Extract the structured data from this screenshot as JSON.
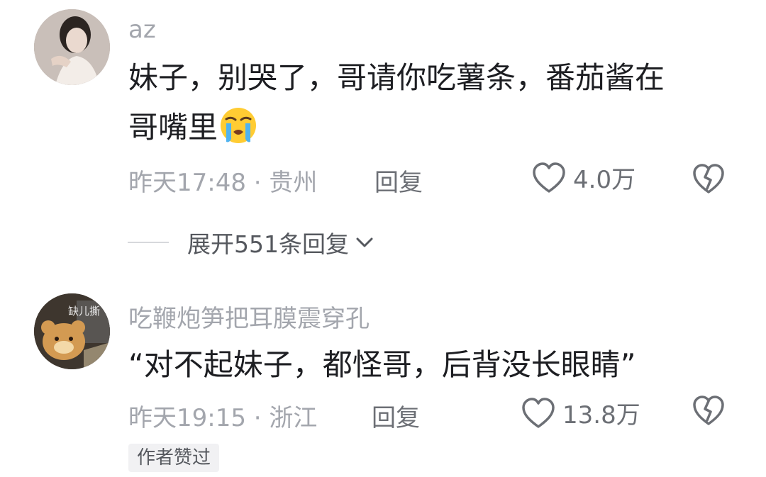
{
  "comments": [
    {
      "username": "az",
      "text_line1": "妹子，别哭了，哥请你吃薯条，番茄酱在",
      "text_line2": "哥嘴里",
      "emoji": "loudly-crying-face",
      "meta": "昨天17:48 · 贵州",
      "reply_label": "回复",
      "likes": "4.0万",
      "expand_label": "展开551条回复"
    },
    {
      "username": "吃鞭炮笋把耳膜震穿孔",
      "text": "“对不起妹子，都怪哥，后背没长眼睛”",
      "avatar_caption": "缺儿撕",
      "meta": "昨天19:15 · 浙江",
      "reply_label": "回复",
      "likes": "13.8万",
      "author_badge": "作者赞过"
    }
  ],
  "colors": {
    "text_primary": "#1d1e22",
    "text_secondary": "#a3a6ad",
    "action": "#6c6f75"
  }
}
